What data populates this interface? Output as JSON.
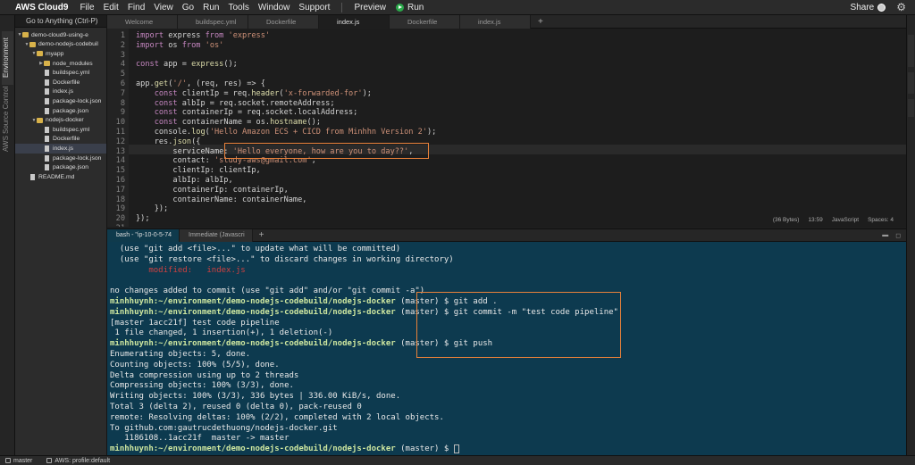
{
  "menubar": {
    "brand": "AWS Cloud9",
    "menus": [
      "File",
      "Edit",
      "Find",
      "View",
      "Go",
      "Run",
      "Tools",
      "Window",
      "Support"
    ],
    "preview": "Preview",
    "run": "Run",
    "share": "Share"
  },
  "left_tabs": [
    "Environment",
    "Source Control",
    "AWS"
  ],
  "sidebar": {
    "goto_label": "Go to Anything (Ctrl-P)",
    "tree": [
      {
        "label": "demo-cloud9-using-e",
        "type": "folder",
        "depth": 0,
        "open": true
      },
      {
        "label": "demo-nodejs-codebuil",
        "type": "folder",
        "depth": 1,
        "open": true
      },
      {
        "label": "myapp",
        "type": "folder",
        "depth": 2,
        "open": true
      },
      {
        "label": "node_modules",
        "type": "folder",
        "depth": 3,
        "open": false
      },
      {
        "label": "buildspec.yml",
        "type": "file",
        "depth": 3
      },
      {
        "label": "Dockerfile",
        "type": "file",
        "depth": 3
      },
      {
        "label": "index.js",
        "type": "file",
        "depth": 3
      },
      {
        "label": "package-lock.json",
        "type": "file",
        "depth": 3
      },
      {
        "label": "package.json",
        "type": "file",
        "depth": 3
      },
      {
        "label": "nodejs-docker",
        "type": "folder",
        "depth": 2,
        "open": true
      },
      {
        "label": "buildspec.yml",
        "type": "file",
        "depth": 3
      },
      {
        "label": "Dockerfile",
        "type": "file",
        "depth": 3
      },
      {
        "label": "index.js",
        "type": "file",
        "depth": 3,
        "selected": true
      },
      {
        "label": "package-lock.json",
        "type": "file",
        "depth": 3
      },
      {
        "label": "package.json",
        "type": "file",
        "depth": 3
      },
      {
        "label": "README.md",
        "type": "file",
        "depth": 1
      }
    ]
  },
  "editor_tabs": [
    {
      "label": "Welcome",
      "active": false
    },
    {
      "label": "buildspec.yml",
      "active": false
    },
    {
      "label": "Dockerfile",
      "active": false
    },
    {
      "label": "index.js",
      "active": true
    },
    {
      "label": "Dockerfile",
      "active": false
    },
    {
      "label": "index.js",
      "active": false
    }
  ],
  "editor": {
    "lines": [
      "import express from 'express'",
      "import os from 'os'",
      "",
      "const app = express();",
      "",
      "app.get('/', (req, res) => {",
      "    const clientIp = req.header('x-forwarded-for');",
      "    const albIp = req.socket.remoteAddress;",
      "    const containerIp = req.socket.localAddress;",
      "    const containerName = os.hostname();",
      "    console.log('Hello Amazon ECS + CICD from Minhhn Version 2');",
      "    res.json({",
      "        serviceName: 'Hello everyone, how are you to day??',",
      "        contact: 'study-aws@gmail.com',",
      "        clientIp: clientIp,",
      "        albIp: albIp,",
      "        containerIp: containerIp,",
      "        containerName: containerName,",
      "    });",
      "});",
      ""
    ],
    "status": {
      "size": "(36 Bytes)",
      "position": "13:59",
      "language": "JavaScript",
      "spaces": "Spaces: 4"
    }
  },
  "terminal_tabs": [
    {
      "label": "bash - \"ip-10-0-5-74",
      "active": true
    },
    {
      "label": "Immediate (Javascri",
      "active": false
    }
  ],
  "terminal": {
    "lines": [
      {
        "text": "  (use \"git add <file>...\" to update what will be committed)"
      },
      {
        "text": "  (use \"git restore <file>...\" to discard changes in working directory)"
      },
      {
        "text": "        modified:   index.js",
        "red": true
      },
      {
        "text": ""
      },
      {
        "text": "no changes added to commit (use \"git add\" and/or \"git commit -a\")"
      },
      {
        "prompt": "minhhuynh:~/environment/demo-nodejs-codebuild/nodejs-docker",
        "text": " (master) $ git add ."
      },
      {
        "prompt": "minhhuynh:~/environment/demo-nodejs-codebuild/nodejs-docker",
        "text": " (master) $ git commit -m \"test code pipeline\""
      },
      {
        "text": "[master 1acc21f] test code pipeline"
      },
      {
        "text": " 1 file changed, 1 insertion(+), 1 deletion(-)"
      },
      {
        "prompt": "minhhuynh:~/environment/demo-nodejs-codebuild/nodejs-docker",
        "text": " (master) $ git push"
      },
      {
        "text": "Enumerating objects: 5, done."
      },
      {
        "text": "Counting objects: 100% (5/5), done."
      },
      {
        "text": "Delta compression using up to 2 threads"
      },
      {
        "text": "Compressing objects: 100% (3/3), done."
      },
      {
        "text": "Writing objects: 100% (3/3), 336 bytes | 336.00 KiB/s, done."
      },
      {
        "text": "Total 3 (delta 2), reused 0 (delta 0), pack-reused 0"
      },
      {
        "text": "remote: Resolving deltas: 100% (2/2), completed with 2 local objects."
      },
      {
        "text": "To github.com:gautrucdethuong/nodejs-docker.git"
      },
      {
        "text": "   1186108..1acc21f  master -> master"
      },
      {
        "prompt": "minhhuynh:~/environment/demo-nodejs-codebuild/nodejs-docker",
        "text": " (master) $ ",
        "cursor": true
      }
    ]
  },
  "bottombar": {
    "branch": "master",
    "aws_profile": "AWS: profile:default"
  },
  "colors": {
    "highlight_box": "#e8813a",
    "terminal_bg": "#0d3a4f",
    "prompt": "#cfe8a0"
  }
}
